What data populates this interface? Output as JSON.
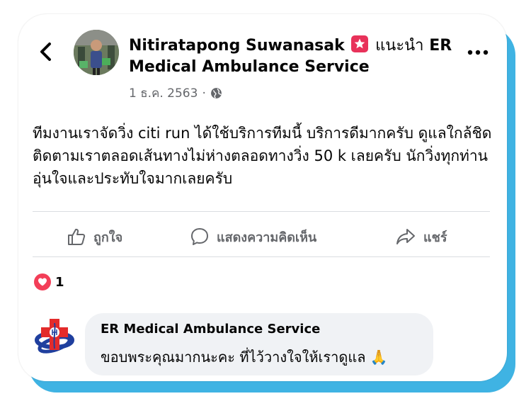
{
  "post": {
    "author": "Nitiratapong Suwanasak",
    "recommends_label": "แนะนำ",
    "page_name": "ER Medical Ambulance Service",
    "date": "1 ธ.ค. 2563",
    "separator": "·",
    "privacy_icon": "globe-icon",
    "text": "ทีมงานเราจัดวิ่ง citi run ได้ใช้บริการทีมนี้ บริการดีมากครับ ดูแลใกล้ชิดติดตามเราตลอดเส้นทางไม่ห่างตลอดทางวิ่ง 50 k เลยครับ นักวิ่งทุกท่านอุ่นใจและประทับใจมากเลยครับ"
  },
  "actions": {
    "like_label": "ถูกใจ",
    "comment_label": "แสดงความคิดเห็น",
    "share_label": "แชร์"
  },
  "reactions": {
    "count": "1",
    "icon": "heart-icon"
  },
  "comment": {
    "author": "ER Medical Ambulance Service",
    "text": "ขอบพระคุณมากนะคะ ที่ไว้วางใจให้เราดูแล",
    "emoji": "🙏"
  },
  "colors": {
    "accent_shadow": "#3fb3e3",
    "recommend_badge": "#e8325a",
    "heart": "#f33e58",
    "secondary_text": "#65676b",
    "comment_bg": "#f0f2f5"
  }
}
